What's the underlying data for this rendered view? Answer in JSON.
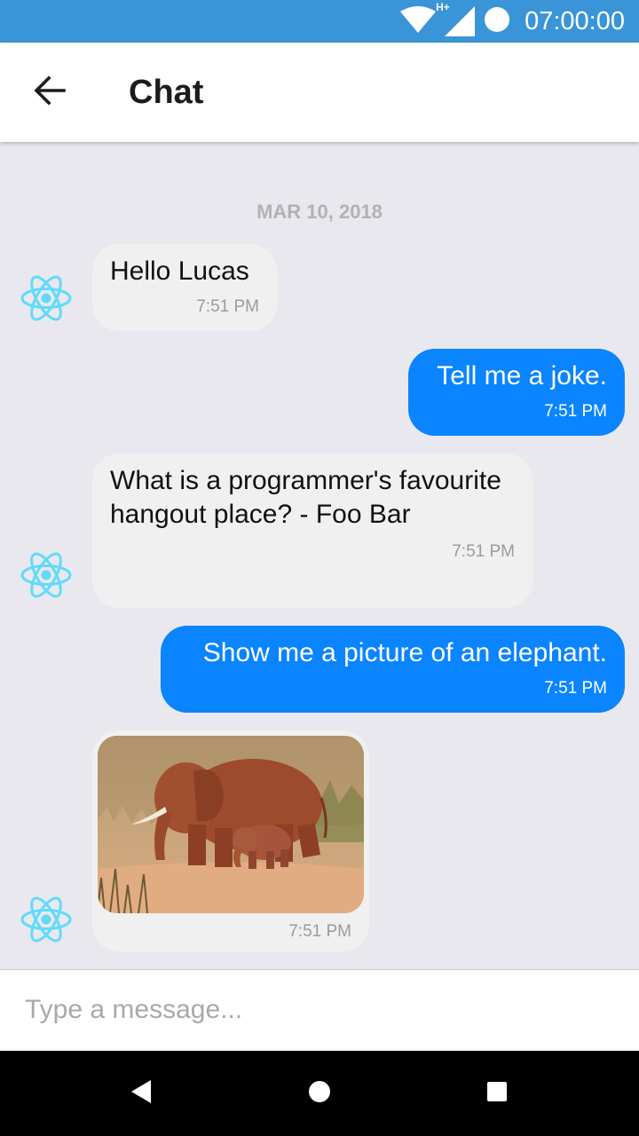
{
  "status_bar": {
    "time": "07:00:00",
    "network_label": "H+",
    "icons": [
      "wifi-icon",
      "signal-icon",
      "battery-icon"
    ]
  },
  "header": {
    "title": "Chat",
    "back_icon": "arrow-left-icon"
  },
  "chat": {
    "date_separator": "MAR 10, 2018",
    "messages": [
      {
        "side": "left",
        "text": "Hello Lucas",
        "time": "7:51 PM"
      },
      {
        "side": "right",
        "text": "Tell me a joke.",
        "time": "7:51 PM"
      },
      {
        "side": "left",
        "text": "What is a programmer's favourite hangout place? - Foo Bar",
        "time": "7:51 PM"
      },
      {
        "side": "right",
        "text": "Show me a picture of an elephant.",
        "time": "7:51 PM"
      },
      {
        "side": "left",
        "image": "elephant-photo",
        "time": "7:51 PM"
      }
    ],
    "avatar_icon": "react-logo-icon"
  },
  "composer": {
    "placeholder": "Type a message..."
  },
  "nav_bar": {
    "icons": [
      "back-triangle-icon",
      "home-circle-icon",
      "recents-square-icon"
    ]
  },
  "colors": {
    "status_bar": "#3a95d8",
    "outgoing_bubble": "#0a84ff",
    "incoming_bubble": "#f0f0f0",
    "chat_background": "#e9e8ef",
    "avatar_accent": "#61dafb"
  }
}
